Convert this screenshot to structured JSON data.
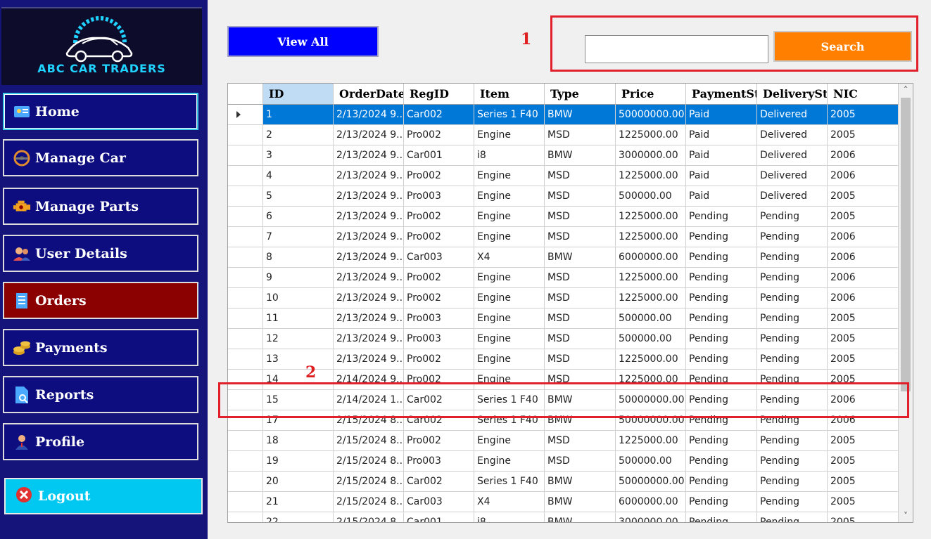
{
  "brand": {
    "name": "ABC CAR TRADERS",
    "color": "#1fd2ff"
  },
  "nav": {
    "items": [
      {
        "label": "Home",
        "icon": "home-card-icon"
      },
      {
        "label": "Manage Car",
        "icon": "steering-wheel-icon"
      },
      {
        "label": "Manage Parts",
        "icon": "engine-icon"
      },
      {
        "label": "User Details",
        "icon": "users-icon"
      },
      {
        "label": "Orders",
        "icon": "document-icon"
      },
      {
        "label": "Payments",
        "icon": "coins-icon"
      },
      {
        "label": "Reports",
        "icon": "report-search-icon"
      },
      {
        "label": "Profile",
        "icon": "person-icon"
      }
    ],
    "active": "Orders",
    "logout": "Logout"
  },
  "toolbar": {
    "view_all": "View All",
    "search_label": "Search",
    "search_value": ""
  },
  "annotations": {
    "first": "1",
    "second": "2"
  },
  "grid": {
    "columns": [
      "",
      "ID",
      "OrderDate",
      "RegID",
      "Item",
      "Type",
      "Price",
      "PaymentSt",
      "DeliverySt",
      "NIC"
    ],
    "rows": [
      [
        "1",
        "2/13/2024 9...",
        "Car002",
        "Series 1 F40",
        "BMW",
        "50000000.00",
        "Paid",
        "Delivered",
        "2005"
      ],
      [
        "2",
        "2/13/2024 9...",
        "Pro002",
        "Engine",
        "MSD",
        "1225000.00",
        "Paid",
        "Delivered",
        "2005"
      ],
      [
        "3",
        "2/13/2024 9...",
        "Car001",
        "i8",
        "BMW",
        "3000000.00",
        "Paid",
        "Delivered",
        "2006"
      ],
      [
        "4",
        "2/13/2024 9...",
        "Pro002",
        "Engine",
        "MSD",
        "1225000.00",
        "Paid",
        "Delivered",
        "2006"
      ],
      [
        "5",
        "2/13/2024 9...",
        "Pro003",
        "Engine",
        "MSD",
        "500000.00",
        "Paid",
        "Delivered",
        "2005"
      ],
      [
        "6",
        "2/13/2024 9...",
        "Pro002",
        "Engine",
        "MSD",
        "1225000.00",
        "Pending",
        "Pending",
        "2005"
      ],
      [
        "7",
        "2/13/2024 9...",
        "Pro002",
        "Engine",
        "MSD",
        "1225000.00",
        "Pending",
        "Pending",
        "2006"
      ],
      [
        "8",
        "2/13/2024 9...",
        "Car003",
        "X4",
        "BMW",
        "6000000.00",
        "Pending",
        "Pending",
        "2006"
      ],
      [
        "9",
        "2/13/2024 9...",
        "Pro002",
        "Engine",
        "MSD",
        "1225000.00",
        "Pending",
        "Pending",
        "2006"
      ],
      [
        "10",
        "2/13/2024 9...",
        "Pro002",
        "Engine",
        "MSD",
        "1225000.00",
        "Pending",
        "Pending",
        "2006"
      ],
      [
        "11",
        "2/13/2024 9...",
        "Pro003",
        "Engine",
        "MSD",
        "500000.00",
        "Pending",
        "Pending",
        "2005"
      ],
      [
        "12",
        "2/13/2024 9...",
        "Pro003",
        "Engine",
        "MSD",
        "500000.00",
        "Pending",
        "Pending",
        "2005"
      ],
      [
        "13",
        "2/13/2024 9...",
        "Pro002",
        "Engine",
        "MSD",
        "1225000.00",
        "Pending",
        "Pending",
        "2005"
      ],
      [
        "14",
        "2/14/2024 9...",
        "Pro002",
        "Engine",
        "MSD",
        "1225000.00",
        "Pending",
        "Pending",
        "2005"
      ],
      [
        "15",
        "2/14/2024 1...",
        "Car002",
        "Series 1 F40",
        "BMW",
        "50000000.00",
        "Pending",
        "Pending",
        "2006"
      ],
      [
        "17",
        "2/15/2024 8...",
        "Car002",
        "Series 1 F40",
        "BMW",
        "50000000.00",
        "Pending",
        "Pending",
        "2006"
      ],
      [
        "18",
        "2/15/2024 8...",
        "Pro002",
        "Engine",
        "MSD",
        "1225000.00",
        "Pending",
        "Pending",
        "2005"
      ],
      [
        "19",
        "2/15/2024 8...",
        "Pro003",
        "Engine",
        "MSD",
        "500000.00",
        "Pending",
        "Pending",
        "2005"
      ],
      [
        "20",
        "2/15/2024 8...",
        "Car002",
        "Series 1 F40",
        "BMW",
        "50000000.00",
        "Pending",
        "Pending",
        "2005"
      ],
      [
        "21",
        "2/15/2024 8...",
        "Car003",
        "X4",
        "BMW",
        "6000000.00",
        "Pending",
        "Pending",
        "2005"
      ],
      [
        "22",
        "2/15/2024 8...",
        "Car001",
        "i8",
        "BMW",
        "3000000.00",
        "Pending",
        "Pending",
        "2005"
      ]
    ],
    "selected_row": 0,
    "selected_header": "ID"
  },
  "colors": {
    "sidebar_bg": "#14147a",
    "nav_bg": "#0d0d80",
    "active_bg": "#8b0000",
    "logout_bg": "#00c8f0",
    "view_all_bg": "#0000ff",
    "search_bg": "#ff8000",
    "selection": "#0078d7",
    "annotation": "#e0202a"
  }
}
